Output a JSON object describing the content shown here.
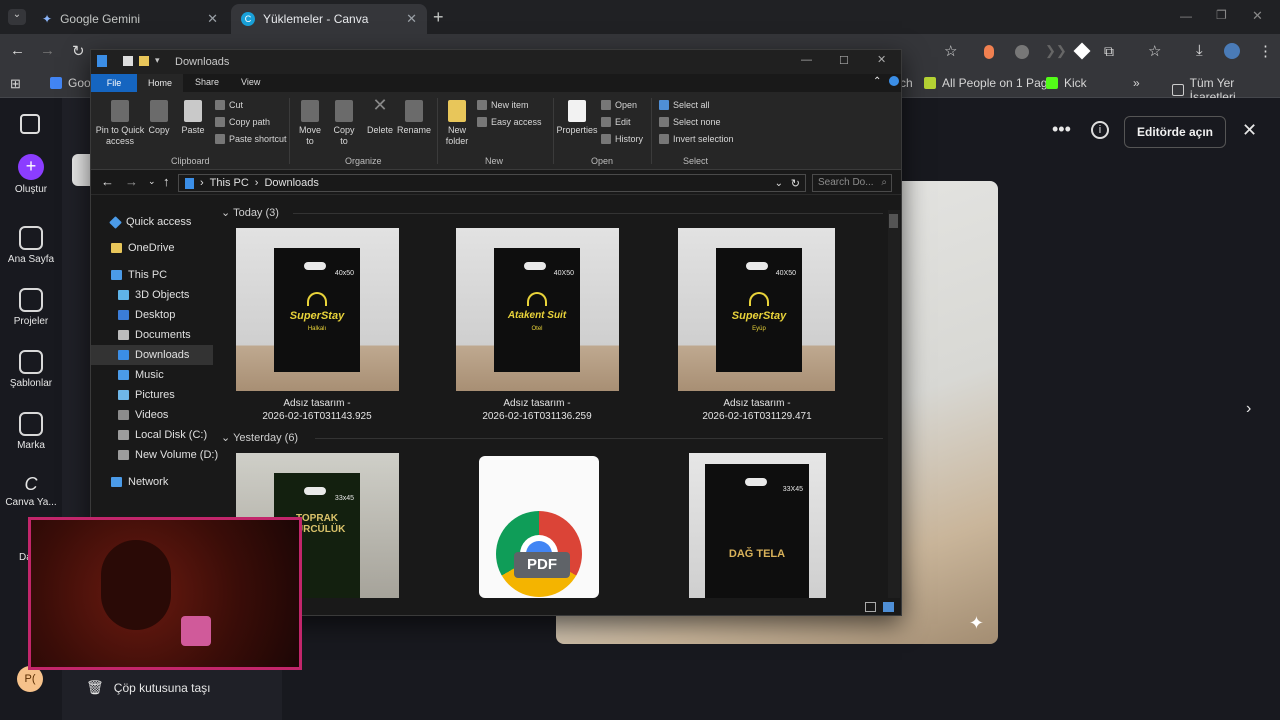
{
  "browser": {
    "tabs": [
      {
        "title": "Google Gemini",
        "active": false
      },
      {
        "title": "Yüklemeler - Canva",
        "active": true
      }
    ],
    "new_tab": "+",
    "bookmarks": [
      {
        "label": "Goog"
      },
      {
        "label": "ch"
      },
      {
        "label": "All People on 1 Page"
      },
      {
        "label": "Kick"
      },
      {
        "label": "Tüm Yer İşaretleri"
      }
    ]
  },
  "canva": {
    "nav": [
      {
        "label": "Oluştur",
        "icon": "plus-icon"
      },
      {
        "label": "Ana Sayfa",
        "icon": "home-icon"
      },
      {
        "label": "Projeler",
        "icon": "folder-icon"
      },
      {
        "label": "Şablonlar",
        "icon": "template-icon"
      },
      {
        "label": "Marka",
        "icon": "brand-icon"
      },
      {
        "label": "Canva Ya...",
        "icon": "canva-ai-icon"
      },
      {
        "label": "Daha",
        "icon": "more-icon"
      }
    ],
    "avatar": "P(",
    "edit_button": "Editörde açın",
    "trash_label": "Çöp kutusuna taşı",
    "accent": "#8b3dff"
  },
  "explorer": {
    "title": "Downloads",
    "ribbon_tabs": [
      "File",
      "Home",
      "Share",
      "View"
    ],
    "clipboard": {
      "pin": "Pin to Quick access",
      "copy": "Copy",
      "paste": "Paste",
      "cut": "Cut",
      "copy_path": "Copy path",
      "paste_shortcut": "Paste shortcut",
      "group": "Clipboard"
    },
    "organize": {
      "move_to": "Move to",
      "copy_to": "Copy to",
      "delete": "Delete",
      "rename": "Rename",
      "group": "Organize"
    },
    "new": {
      "new_folder": "New folder",
      "new_item": "New item",
      "easy_access": "Easy access",
      "group": "New"
    },
    "open": {
      "properties": "Properties",
      "open": "Open",
      "edit": "Edit",
      "history": "History",
      "group": "Open"
    },
    "select": {
      "select_all": "Select all",
      "select_none": "Select none",
      "invert": "Invert selection",
      "group": "Select"
    },
    "address": {
      "this_pc": "This PC",
      "downloads": "Downloads",
      "search_placeholder": "Search Do..."
    },
    "nav_pane": [
      "Quick access",
      "OneDrive",
      "This PC",
      "3D Objects",
      "Desktop",
      "Documents",
      "Downloads",
      "Music",
      "Pictures",
      "Videos",
      "Local Disk (C:)",
      "New Volume (D:)",
      "Network"
    ],
    "groups": {
      "today": "Today (3)",
      "yesterday": "Yesterday (6)"
    },
    "today_files": [
      {
        "line1": "Adsız tasarım -",
        "line2": "2026-02-16T031143.925",
        "brand": "SuperStay",
        "sub": "Halkalı",
        "size": "40x50"
      },
      {
        "line1": "Adsız tasarım -",
        "line2": "2026-02-16T031136.259",
        "brand": "Atakent Suit",
        "sub": "Otel",
        "size": "40X50"
      },
      {
        "line1": "Adsız tasarım -",
        "line2": "2026-02-16T031129.471",
        "brand": "SuperStay",
        "sub": "Eyüp",
        "size": "40X50"
      }
    ],
    "yesterday_files": [
      {
        "brand": "TOPRAK\nKÜRCÜLÜK",
        "size": "33x45"
      },
      {
        "brand": "PDF"
      },
      {
        "brand": "DAĞ TELA",
        "size": "33X45"
      }
    ]
  }
}
